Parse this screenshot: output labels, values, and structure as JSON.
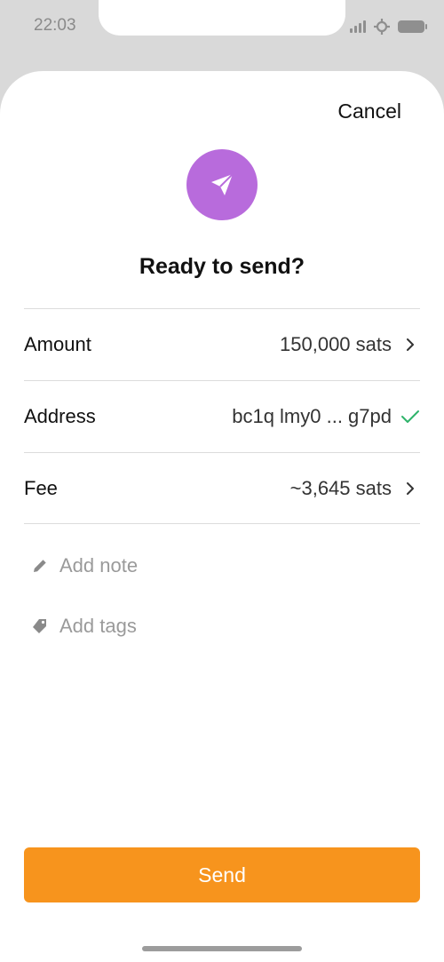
{
  "status_bar": {
    "time": "22:03"
  },
  "header": {
    "cancel_label": "Cancel",
    "title": "Ready to send?"
  },
  "rows": [
    {
      "label": "Amount",
      "value": "150,000 sats",
      "icon": "chevron-right-icon"
    },
    {
      "label": "Address",
      "value": "bc1q lmy0 ... g7pd",
      "icon": "check-icon"
    },
    {
      "label": "Fee",
      "value": "~3,645 sats",
      "icon": "chevron-right-icon"
    }
  ],
  "actions": {
    "note_label": "Add note",
    "tags_label": "Add tags"
  },
  "send_button": {
    "label": "Send"
  },
  "colors": {
    "accent": "#f7941d",
    "badge": "#b86bdc",
    "check": "#2eb36a",
    "muted": "#9a9a9a"
  }
}
